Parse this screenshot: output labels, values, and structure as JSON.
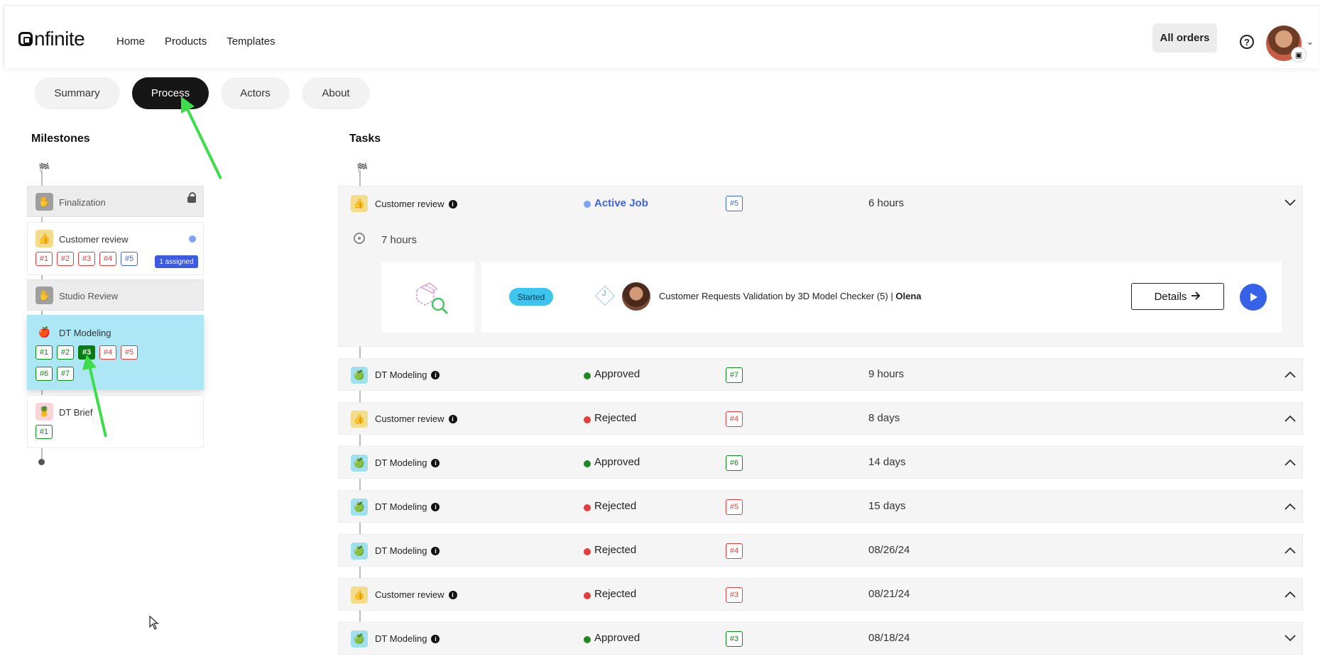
{
  "header": {
    "logo": "nfinite",
    "nav": [
      "Home",
      "Products",
      "Templates"
    ],
    "all_orders": "All orders",
    "help_glyph": "?"
  },
  "tabs": [
    {
      "label": "Summary",
      "active": false
    },
    {
      "label": "Process",
      "active": true
    },
    {
      "label": "Actors",
      "active": false
    },
    {
      "label": "About",
      "active": false
    }
  ],
  "milestones": {
    "title": "Milestones",
    "items": [
      {
        "label": "Finalization",
        "locked": true,
        "icon": "hand-icon"
      },
      {
        "label": "Customer review",
        "icon": "thumbs-up-icon",
        "chips": [
          "#1",
          "#2",
          "#3",
          "#4",
          "#5"
        ],
        "badge": "1 assigned"
      },
      {
        "label": "Studio Review",
        "icon": "hand-icon"
      },
      {
        "label": "DT Modeling",
        "icon": "apple-icon",
        "chips_row1": [
          "#1",
          "#2",
          "#3",
          "#4",
          "#5"
        ],
        "chips_row2": [
          "#6",
          "#7"
        ]
      },
      {
        "label": "DT Brief",
        "icon": "pineapple-icon",
        "chips": [
          "#1"
        ]
      }
    ]
  },
  "tasks": {
    "title": "Tasks",
    "active_job": {
      "name": "Customer review",
      "status": "Active Job",
      "chip": "#5",
      "time": "6 hours",
      "hours": "7 hours",
      "started": "Started",
      "letter": "J",
      "description": "Customer Requests Validation by 3D Model Checker (5) |",
      "actor": "Olena",
      "details": "Details"
    },
    "rows": [
      {
        "name": "DT Modeling",
        "status": "Approved",
        "chip": "#7",
        "time": "9 hours"
      },
      {
        "name": "Customer review",
        "status": "Rejected",
        "chip": "#4",
        "time": "8 days"
      },
      {
        "name": "DT Modeling",
        "status": "Approved",
        "chip": "#6",
        "time": "14 days"
      },
      {
        "name": "DT Modeling",
        "status": "Rejected",
        "chip": "#5",
        "time": "15 days"
      },
      {
        "name": "DT Modeling",
        "status": "Rejected",
        "chip": "#4",
        "time": "08/26/24"
      },
      {
        "name": "Customer review",
        "status": "Rejected",
        "chip": "#3",
        "time": "08/21/24"
      },
      {
        "name": "DT Modeling",
        "status": "Approved",
        "chip": "#3",
        "time": "08/18/24"
      }
    ]
  },
  "colors": {
    "approved": "#1f8a1f",
    "rejected": "#e53c3c",
    "active": "#3e64e6",
    "annotation_arrow": "#3ddc4a"
  }
}
